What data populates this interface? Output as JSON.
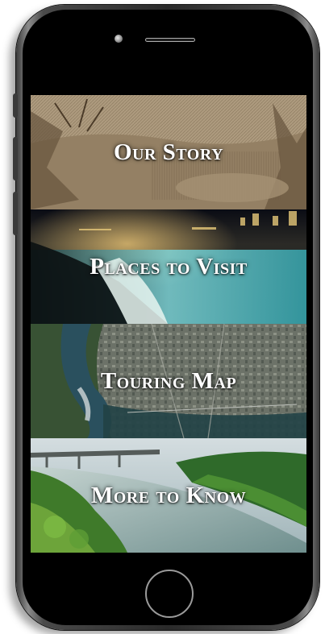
{
  "menu": {
    "items": [
      {
        "label": "Our Story",
        "image": "engraving-of-falls"
      },
      {
        "label": "Places to Visit",
        "image": "falls-at-night"
      },
      {
        "label": "Touring Map",
        "image": "aerial-map"
      },
      {
        "label": "More to Know",
        "image": "river-gorge-green"
      }
    ]
  },
  "device": {
    "type": "smartphone",
    "frame_color": "#000000"
  }
}
